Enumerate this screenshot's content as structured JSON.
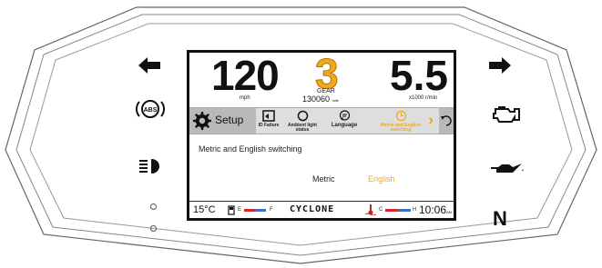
{
  "speed": {
    "value": "120",
    "unit": "mph"
  },
  "gear": {
    "value": "3",
    "label": "GEAR"
  },
  "odometer": {
    "value": "130060",
    "unit": "mile"
  },
  "rpm": {
    "value": "5.5",
    "unit": "x1000 r/min"
  },
  "menu": {
    "setup_label": "Setup",
    "items": [
      {
        "label": "ID Failure",
        "icon": "id-failure-icon"
      },
      {
        "label": "Ambient light status",
        "icon": "ambient-light-icon"
      },
      {
        "label": "Language",
        "icon": "language-icon"
      },
      {
        "label": "Metric and English switching",
        "icon": "metric-english-icon",
        "selected": true
      }
    ]
  },
  "content": {
    "title": "Metric and English switching",
    "options": [
      "Metric",
      "English"
    ],
    "selected": "English"
  },
  "status": {
    "temperature": "15°C",
    "fuel_low": "E",
    "fuel_high": "F",
    "brand": "CYCLONE",
    "coolant_low": "C",
    "coolant_high": "H",
    "time": "10:06",
    "ampm": "AM"
  },
  "indicators": {
    "abs": "ABS",
    "neutral": "N"
  },
  "colors": {
    "accent": "#f2a81d",
    "menu_bg": "#dedede",
    "setup_bg": "#b9b9b9"
  }
}
